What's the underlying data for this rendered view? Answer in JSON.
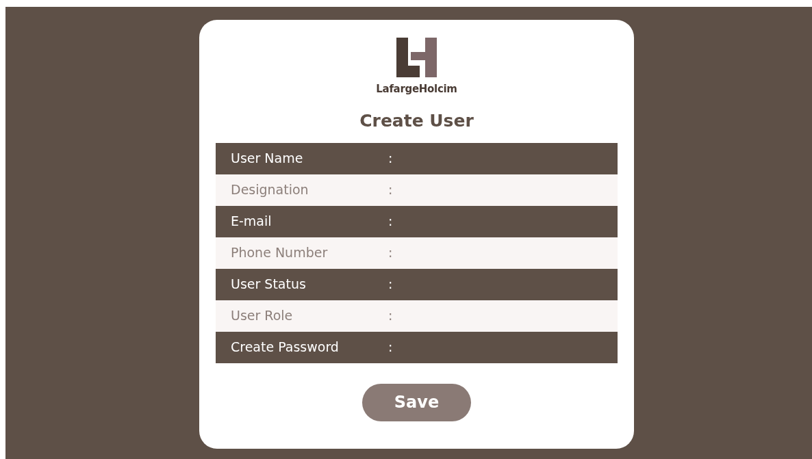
{
  "logo": {
    "text": "LafargeHolcim"
  },
  "title": "Create User",
  "rows": [
    {
      "label": "User Name",
      "separator": ":",
      "kind": "dark"
    },
    {
      "label": "Designation",
      "separator": ":",
      "kind": "light"
    },
    {
      "label": "E-mail",
      "separator": ":",
      "kind": "dark"
    },
    {
      "label": "Phone Number",
      "separator": ":",
      "kind": "light"
    },
    {
      "label": "User Status",
      "separator": ":",
      "kind": "dark"
    },
    {
      "label": "User Role",
      "separator": ":",
      "kind": "light"
    },
    {
      "label": "Create Password",
      "separator": ":",
      "kind": "dark"
    }
  ],
  "save_button": "Save"
}
